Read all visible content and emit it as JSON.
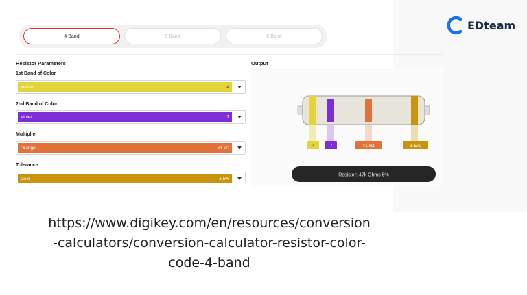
{
  "brand": {
    "name": "EDteam",
    "color": "#1d72e8"
  },
  "tabs": [
    {
      "label": "4 Band",
      "active": true
    },
    {
      "label": "5 Band",
      "active": false
    },
    {
      "label": "6 Band",
      "active": false
    }
  ],
  "left_title": "Resistor Parameters",
  "output_title": "Output",
  "fields": [
    {
      "label": "1st Band of Color",
      "color_name": "Yellow",
      "value": "4",
      "color": "#e2d43a"
    },
    {
      "label": "2nd Band of Color",
      "color_name": "Violet",
      "value": "7",
      "color": "#7d2ed6"
    },
    {
      "label": "Multiplier",
      "color_name": "Orange",
      "value": "×1 kΩ",
      "color": "#e1733a"
    },
    {
      "label": "Tolerance",
      "color_name": "Gold",
      "value": "± 5%",
      "color": "#c9950f"
    }
  ],
  "band_tags": [
    "4",
    "7",
    "×1 kΩ",
    "± 5%"
  ],
  "result": "Resistor: 47k Ohms 5%",
  "url_lines": [
    "https://www.digikey.com/en/resources/conversion",
    "-calculators/conversion-calculator-resistor-color-",
    "code-4-band"
  ]
}
